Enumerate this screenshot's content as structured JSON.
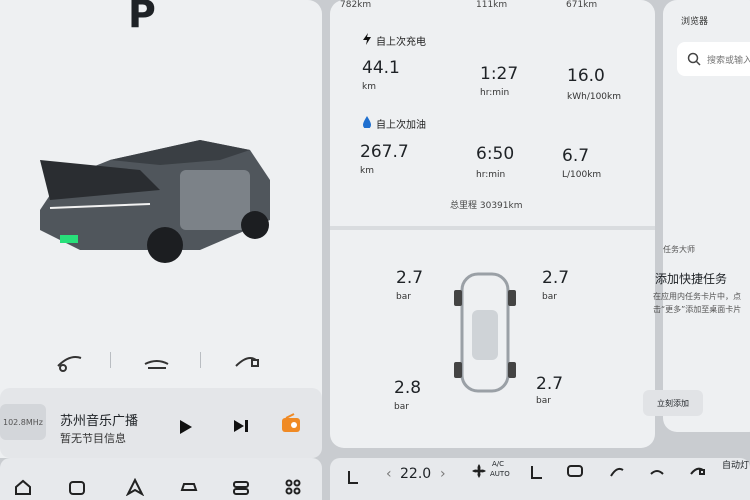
{
  "status": {
    "gear": "P",
    "range_badge": "782km",
    "battery_pct_small": "111km",
    "fuel": "671km"
  },
  "charge": {
    "title": "自上次充电",
    "distance": "44.1",
    "distance_unit": "km",
    "time": "1:27",
    "time_unit": "hr:min",
    "consumption": "16.0",
    "consumption_unit": "kWh/100km"
  },
  "fuel_stats": {
    "title": "自上次加油",
    "distance": "267.7",
    "distance_unit": "km",
    "time": "6:50",
    "time_unit": "hr:min",
    "consumption": "6.7",
    "consumption_unit": "L/100km"
  },
  "odometer": "总里程  30391km",
  "tires": {
    "front_left": "2.7",
    "front_right": "2.7",
    "rear_left": "2.8",
    "rear_right": "2.7",
    "unit": "bar"
  },
  "media": {
    "frequency": "102.8MHz",
    "station": "苏州音乐广播",
    "program": "暂无节目信息"
  },
  "browser": {
    "title": "浏览器",
    "search_placeholder": "搜索或输入"
  },
  "tasks": {
    "section": "任务大师",
    "heading": "添加快捷任务",
    "desc": "在应用内任务卡片中，点击“更多”添加至桌面卡片",
    "button": "立刻添加"
  },
  "climate": {
    "temp": "22.0",
    "ac_label": "A/C",
    "auto_label": "AUTO",
    "right_label": "自动灯"
  }
}
